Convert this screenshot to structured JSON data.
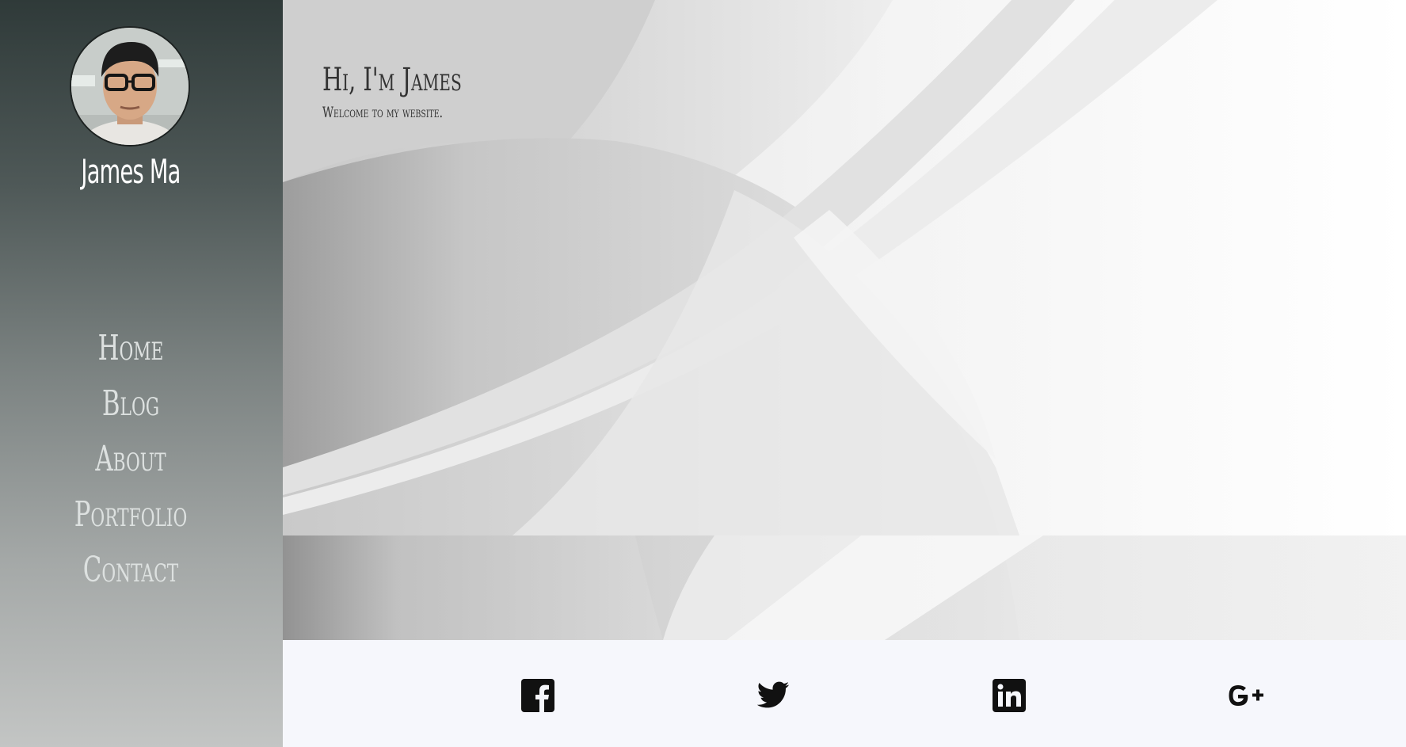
{
  "sidebar": {
    "name": "James Ma",
    "nav": [
      {
        "label": "Home"
      },
      {
        "label": "Blog"
      },
      {
        "label": "About"
      },
      {
        "label": "Portfolio"
      },
      {
        "label": "Contact"
      }
    ]
  },
  "hero": {
    "title": "Hi, I'm James",
    "subtitle": "Welcome to my website."
  },
  "social": {
    "icons": [
      "facebook-icon",
      "twitter-icon",
      "linkedin-icon",
      "google-plus-icon"
    ]
  },
  "colors": {
    "sidebar_top": "#2f3a39",
    "sidebar_bottom": "#c3c5c4",
    "footer_bg": "#f6f7fc",
    "icon_color": "#111111"
  }
}
